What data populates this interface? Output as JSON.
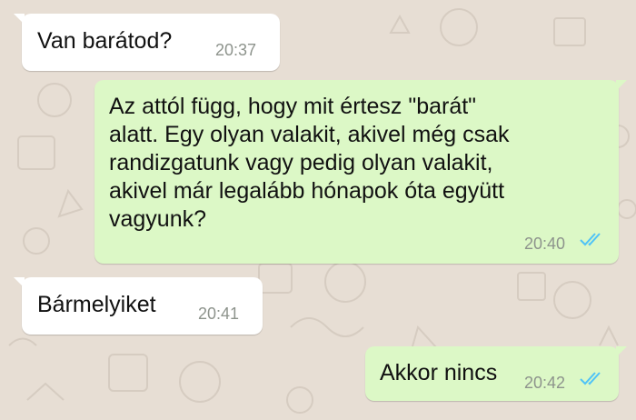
{
  "theme": {
    "background": "#e7ded4",
    "incoming_bubble": "#ffffff",
    "outgoing_bubble": "#dcf8c6",
    "read_ticks": "#4fc3f7"
  },
  "messages": [
    {
      "direction": "incoming",
      "text": "Van barátod?",
      "time": "20:37"
    },
    {
      "direction": "outgoing",
      "text": "Az attól függ, hogy mit értesz \"barát\"\nalatt. Egy olyan valakit, akivel még csak\nrandizgatunk vagy pedig olyan valakit,\nakivel már legalább hónapok óta együtt\nvagyunk?",
      "time": "20:40",
      "status_icon": "double-check-read-icon"
    },
    {
      "direction": "incoming",
      "text": "Bármelyiket",
      "time": "20:41"
    },
    {
      "direction": "outgoing",
      "text": "Akkor nincs",
      "time": "20:42",
      "status_icon": "double-check-read-icon"
    }
  ]
}
